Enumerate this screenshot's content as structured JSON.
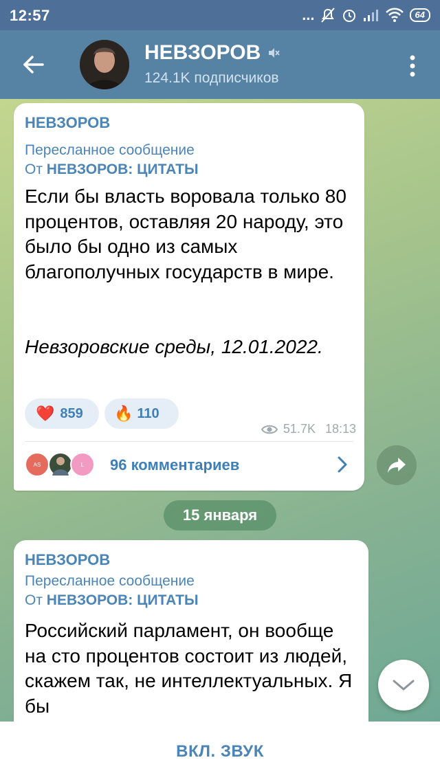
{
  "status_bar": {
    "time": "12:57",
    "battery": "64",
    "dots": "..."
  },
  "header": {
    "channel_name": "НЕВЗОРОВ",
    "subscribers": "124.1K подписчиков",
    "muted_icon": "speaker-muted-icon"
  },
  "messages": [
    {
      "author": "НЕВЗОРОВ",
      "forwarded_label": "Пересланное сообщение",
      "forwarded_prefix": "От",
      "forwarded_from": "НЕВЗОРОВ: ЦИТАТЫ",
      "text": "Если бы власть воровала только 80 процентов, оставляя 20 народу, это было бы одно из самых благополучных государств в мире.",
      "signature": "Невзоровские среды, 12.01.2022.",
      "reactions": [
        {
          "emoji": "❤️",
          "count": "859"
        },
        {
          "emoji": "🔥",
          "count": "110"
        }
      ],
      "views": "51.7K",
      "time": "18:13",
      "comments": {
        "avatars": [
          "AS",
          "",
          "L"
        ],
        "label": "96 комментариев"
      }
    },
    {
      "author": "НЕВЗОРОВ",
      "forwarded_label": "Пересланное сообщение",
      "forwarded_prefix": "От",
      "forwarded_from": "НЕВЗОРОВ: ЦИТАТЫ",
      "text": "Российский парламент, он вообще на сто процентов состоит из людей, скажем так, не интеллектуальных. Я бы"
    }
  ],
  "date_separator": "15 января",
  "bottom_bar": {
    "button_label": "ВКЛ. ЗВУК"
  },
  "colors": {
    "header": "#5682a3",
    "status_bar": "#4e7098",
    "accent": "#4b84b6",
    "reaction_bg": "#e5eef7"
  }
}
